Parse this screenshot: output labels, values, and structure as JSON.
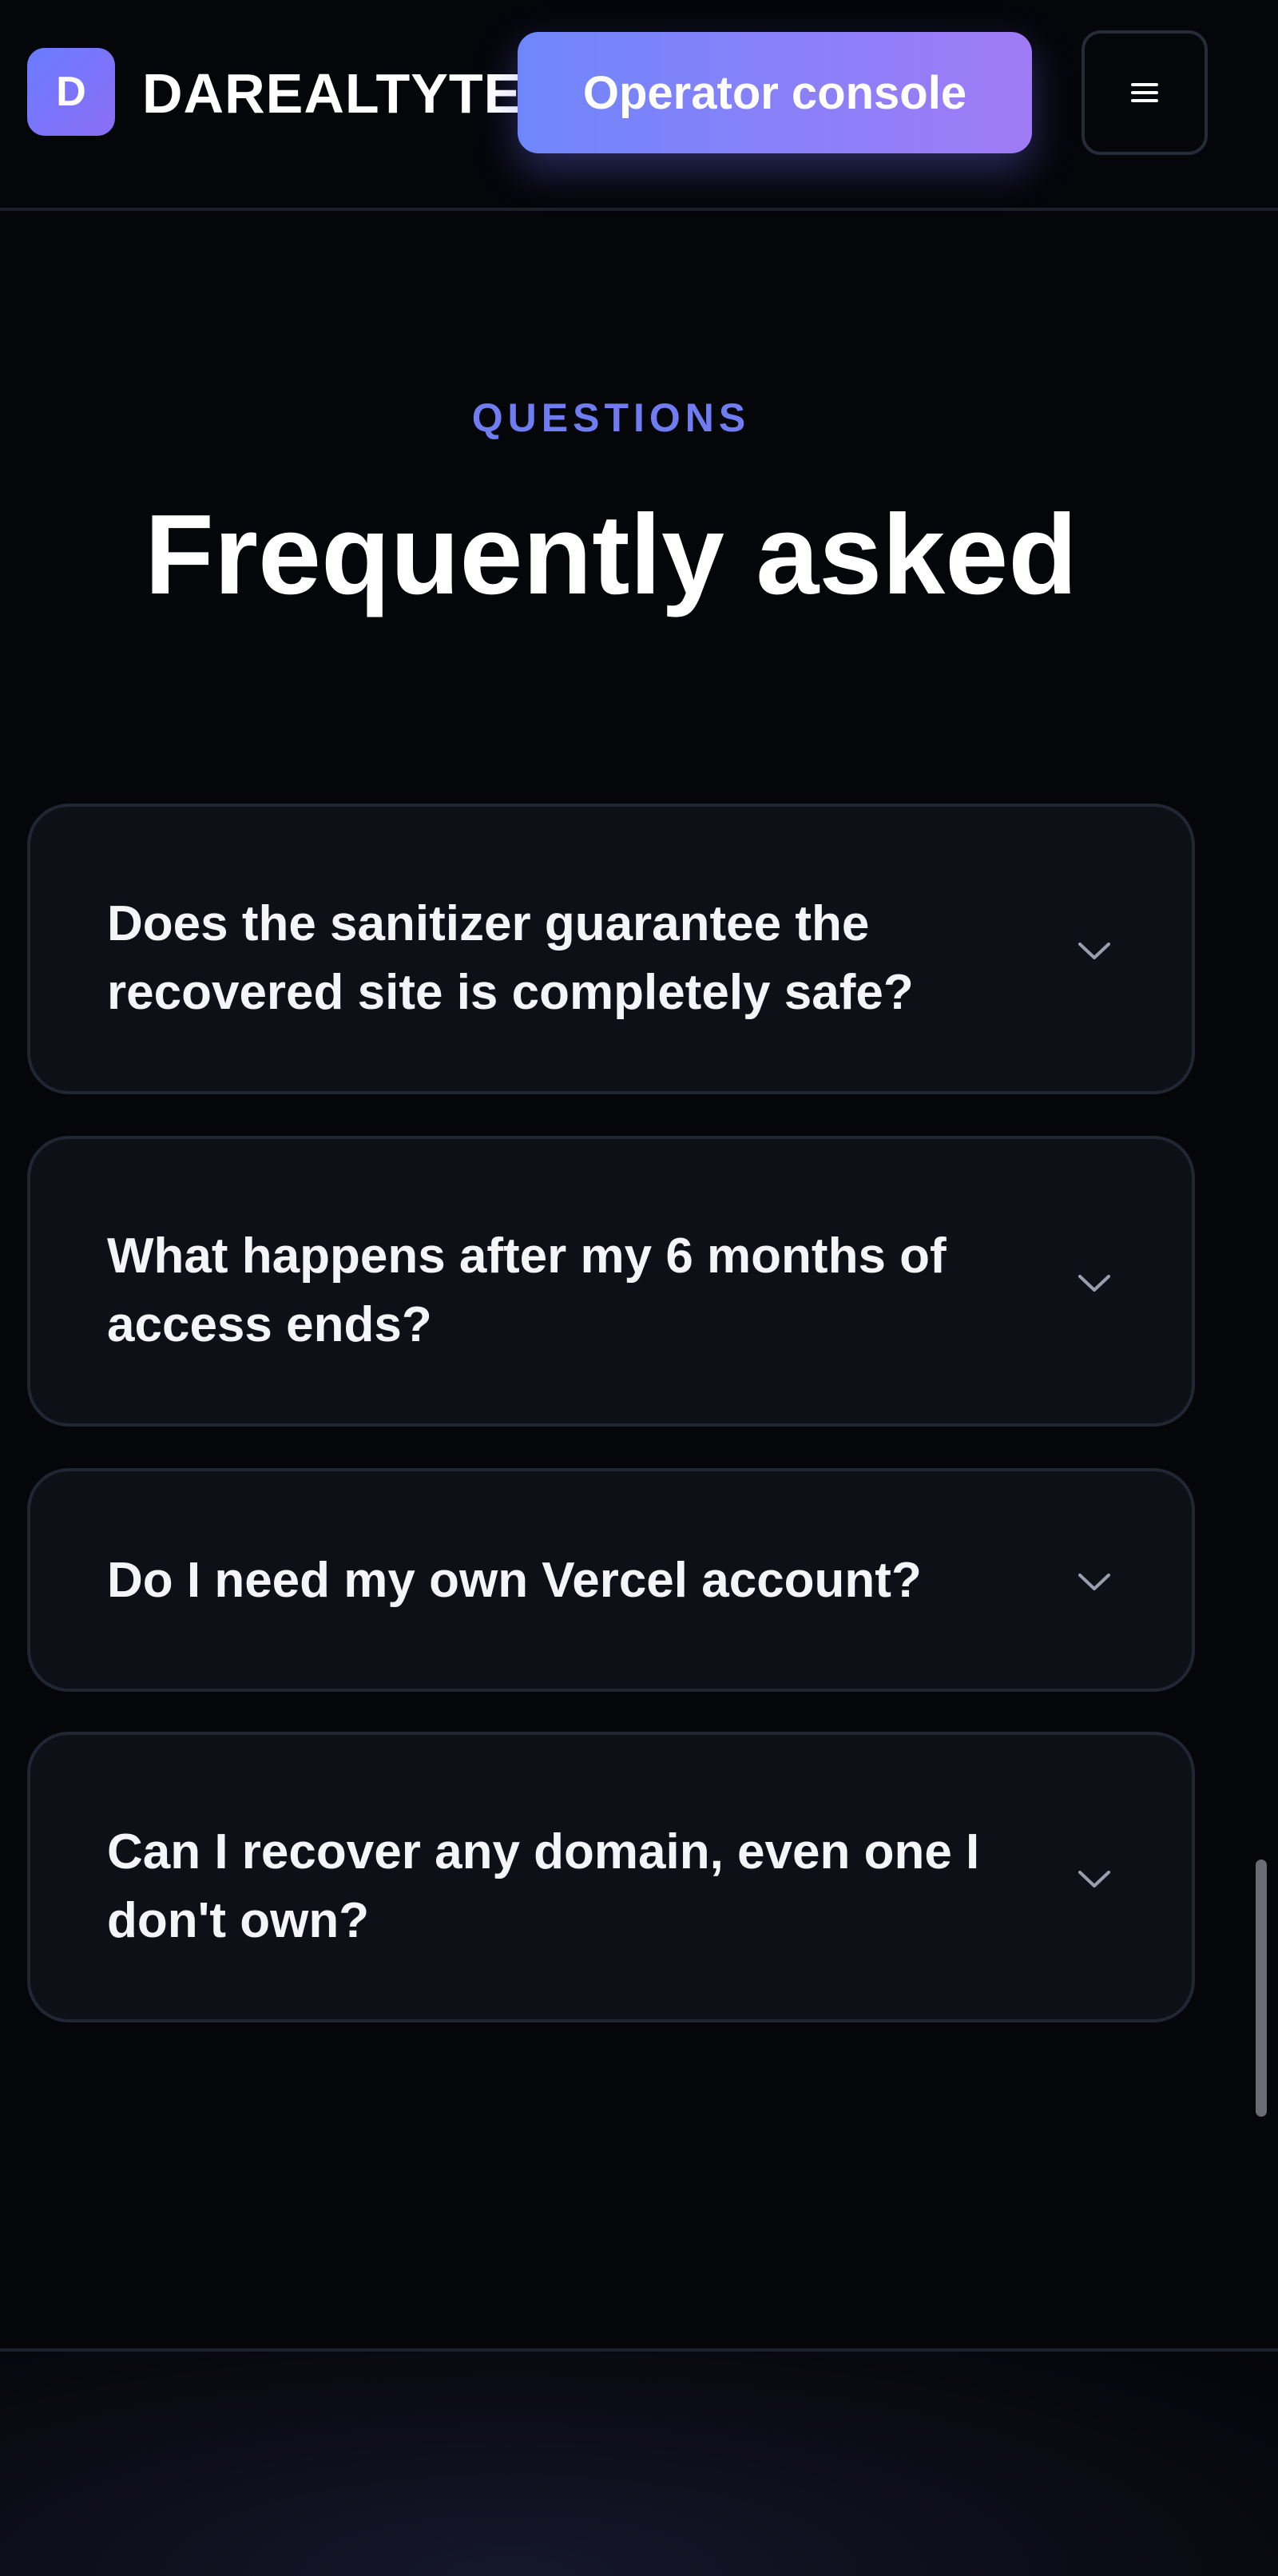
{
  "header": {
    "logo_letter": "D",
    "brand_name": "DAREALTYTE",
    "console_button_label": "Operator console",
    "menu_icon": "hamburger-menu-icon"
  },
  "faq": {
    "eyebrow": "QUESTIONS",
    "title": "Frequently asked",
    "chevron_icon": "chevron-down-icon",
    "items": [
      {
        "question": "Does the sanitizer guarantee the recovered site is completely safe?"
      },
      {
        "question": "What happens after my 6 months of access ends?"
      },
      {
        "question": "Do I need my own Vercel account?"
      },
      {
        "question": "Can I recover any domain, even one I don't own?"
      }
    ]
  },
  "colors": {
    "background": "#05060a",
    "card_background": "#0e1018",
    "card_border": "#222532",
    "accent": "#6f7cf2",
    "button_gradient_start": "#6f86fb",
    "button_gradient_end": "#a07bf6"
  }
}
